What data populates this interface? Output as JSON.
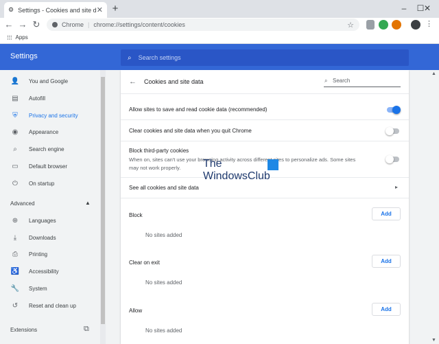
{
  "browser": {
    "tab_title": "Settings - Cookies and site data",
    "address_site": "Chrome",
    "address_url": "chrome://settings/content/cookies",
    "bookmarks_apps": "Apps"
  },
  "header": {
    "title": "Settings",
    "search_placeholder": "Search settings"
  },
  "sidebar": {
    "items": [
      {
        "label": "You and Google",
        "icon": "person-icon"
      },
      {
        "label": "Autofill",
        "icon": "clipboard-icon"
      },
      {
        "label": "Privacy and security",
        "icon": "shield-icon"
      },
      {
        "label": "Appearance",
        "icon": "palette-icon"
      },
      {
        "label": "Search engine",
        "icon": "search-icon"
      },
      {
        "label": "Default browser",
        "icon": "browser-icon"
      },
      {
        "label": "On startup",
        "icon": "power-icon"
      }
    ],
    "advanced_label": "Advanced",
    "advanced_items": [
      {
        "label": "Languages",
        "icon": "globe-icon"
      },
      {
        "label": "Downloads",
        "icon": "download-icon"
      },
      {
        "label": "Printing",
        "icon": "printer-icon"
      },
      {
        "label": "Accessibility",
        "icon": "accessibility-icon"
      },
      {
        "label": "System",
        "icon": "wrench-icon"
      },
      {
        "label": "Reset and clean up",
        "icon": "reset-icon"
      }
    ],
    "extensions_label": "Extensions"
  },
  "page": {
    "title": "Cookies and site data",
    "search_placeholder": "Search",
    "allow_cookies": {
      "label": "Allow sites to save and read cookie data (recommended)",
      "enabled": true
    },
    "clear_on_quit": {
      "label": "Clear cookies and site data when you quit Chrome",
      "enabled": false
    },
    "block_third_party": {
      "label": "Block third-party cookies",
      "desc_line1": "When on, sites can't use your browsing activity across different sites to personalize ads. Some sites",
      "desc_line2": "may not work properly.",
      "enabled": false
    },
    "see_all": "See all cookies and site data",
    "sections": [
      {
        "title": "Block",
        "add_label": "Add",
        "empty": "No sites added"
      },
      {
        "title": "Clear on exit",
        "add_label": "Add",
        "empty": "No sites added"
      },
      {
        "title": "Allow",
        "add_label": "Add",
        "empty": "No sites added"
      }
    ]
  },
  "watermark": {
    "line1": "The",
    "line2": "WindowsClub"
  },
  "colors": {
    "accent": "#1a73e8",
    "header": "#3367d6"
  }
}
